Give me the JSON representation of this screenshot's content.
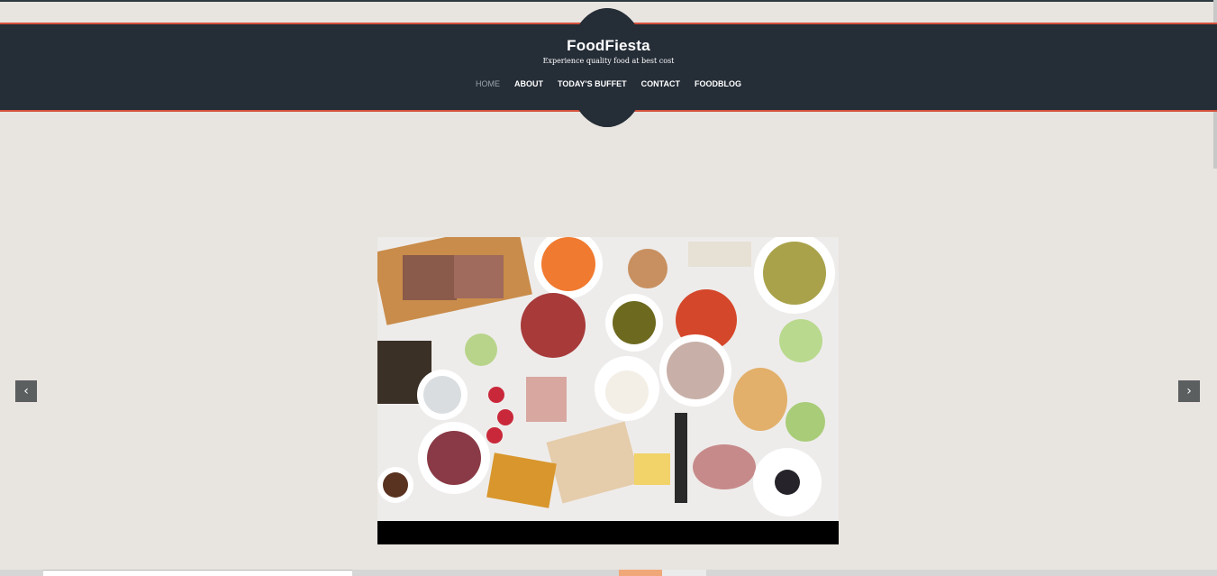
{
  "site": {
    "title": "FoodFiesta",
    "tagline": "Experience quality food at best cost"
  },
  "nav": {
    "items": [
      "HOME",
      "ABOUT",
      "TODAY'S BUFFET",
      "CONTACT",
      "FOODBLOG"
    ],
    "active": "HOME"
  },
  "slider": {
    "prev_icon": "chevron-left-icon",
    "next_icon": "chevron-right-icon",
    "prev_glyph": "‹",
    "next_glyph": "›"
  },
  "colors": {
    "header_bg": "#252d37",
    "accent": "#d4503a",
    "page_bg": "#e8e4df"
  }
}
